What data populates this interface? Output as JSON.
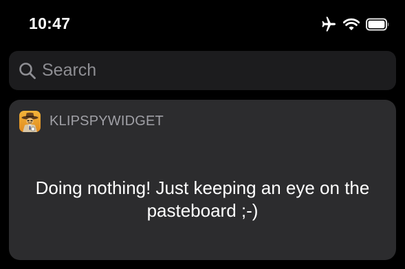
{
  "status_bar": {
    "time": "10:47",
    "icons": [
      "airplane-icon",
      "wifi-icon",
      "battery-icon"
    ]
  },
  "search": {
    "placeholder": "Search",
    "value": "",
    "icon": "search-icon"
  },
  "widget": {
    "app_name": "KLIPSPYWIDGET",
    "app_icon": "spy-detective-icon",
    "message": "Doing nothing! Just keeping an eye on the pasteboard ;-)"
  },
  "colors": {
    "background": "#000000",
    "search_background": "#1c1c1e",
    "widget_background": "#2c2c2e",
    "secondary_text": "#a0a0a6",
    "placeholder_text": "#8e8e93",
    "primary_text": "#ffffff"
  }
}
